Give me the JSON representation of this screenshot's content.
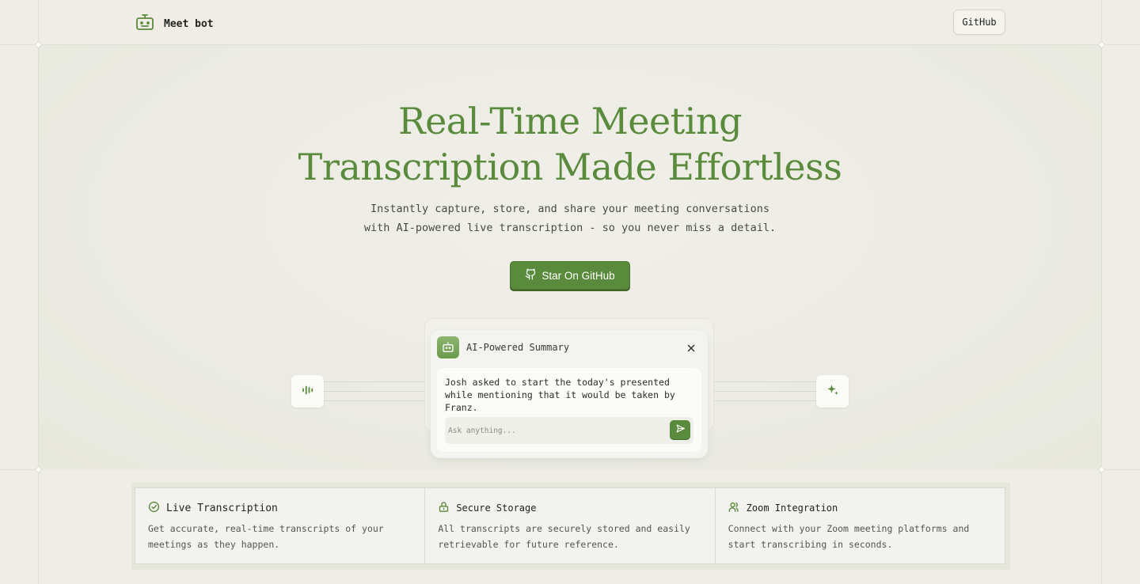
{
  "header": {
    "brand_name": "Meet bot",
    "github_label": "GitHub"
  },
  "hero": {
    "title_line1": "Real-Time Meeting",
    "title_line2": "Transcription Made Effortless",
    "subtitle_line1": "Instantly capture, store, and share your meeting conversations",
    "subtitle_line2": "with AI-powered live transcription - so you never miss a detail.",
    "cta_label": "Star On GitHub"
  },
  "summary_card": {
    "title": "AI-Powered Summary",
    "text": "Josh asked to start the today's presented while mentioning that it would be taken by Franz.",
    "input_placeholder": "Ask anything..."
  },
  "features": [
    {
      "icon": "check-circle-icon",
      "title": "Live Transcription",
      "desc": "Get accurate, real-time transcripts of your meetings as they happen."
    },
    {
      "icon": "lock-icon",
      "title": "Secure Storage",
      "desc": "All transcripts are securely stored and easily retrievable for future reference."
    },
    {
      "icon": "users-icon",
      "title": "Zoom Integration",
      "desc": "Connect with your Zoom meeting platforms and start transcribing in seconds."
    }
  ],
  "colors": {
    "accent": "#5a8a3c",
    "background": "#efede6"
  }
}
